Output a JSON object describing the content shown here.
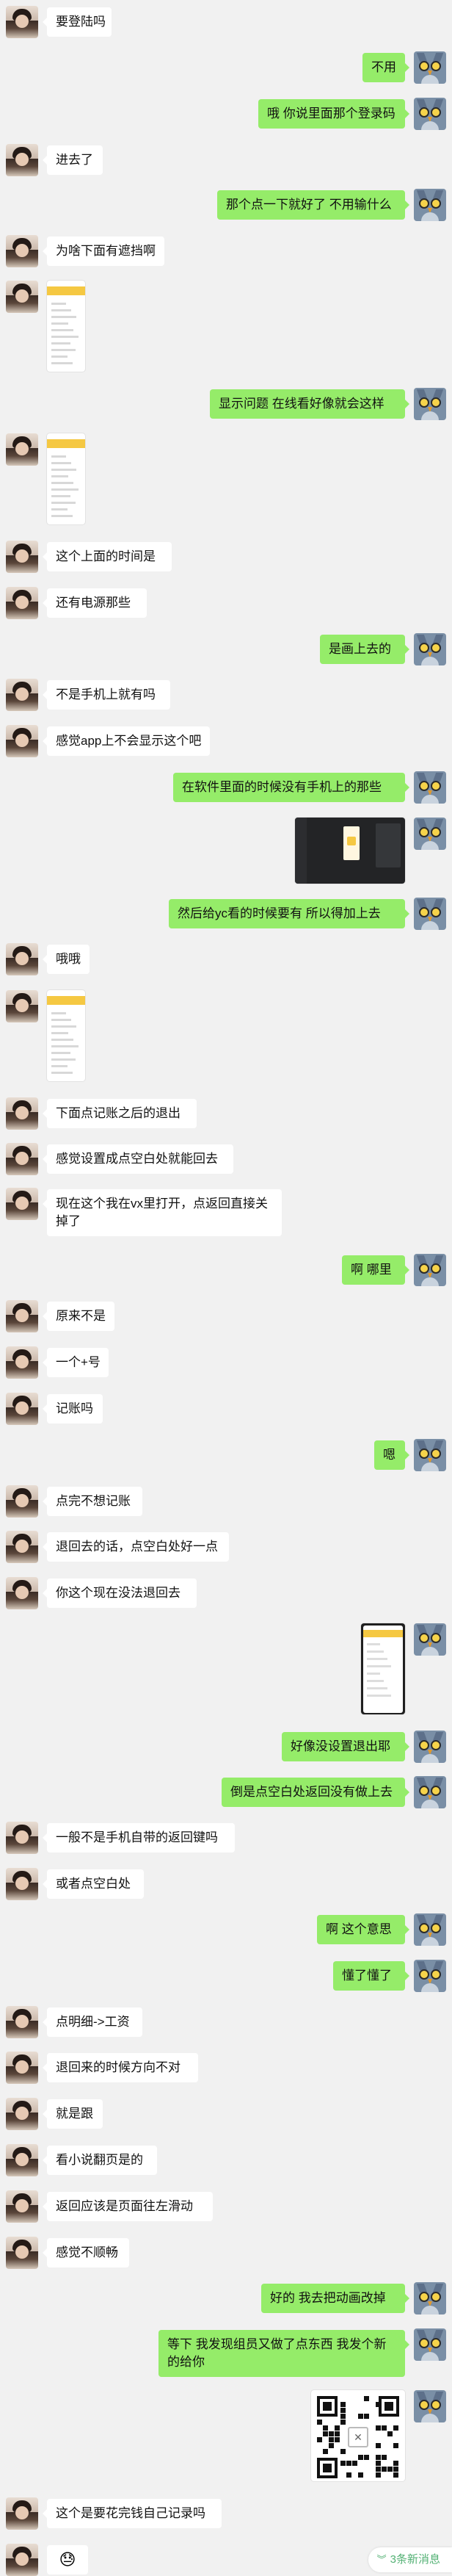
{
  "messages": [
    {
      "side": "left",
      "type": "text",
      "text": "要登陆吗"
    },
    {
      "side": "right",
      "type": "text",
      "text": "不用"
    },
    {
      "side": "right",
      "type": "text",
      "text": "哦 你说里面那个登录码"
    },
    {
      "side": "left",
      "type": "text",
      "text": "进去了"
    },
    {
      "side": "right",
      "type": "text",
      "text": "那个点一下就好了 不用输什么"
    },
    {
      "side": "left",
      "type": "text",
      "text": "为啥下面有遮挡啊"
    },
    {
      "side": "left",
      "type": "image",
      "kind": "phone-screenshot"
    },
    {
      "side": "right",
      "type": "text",
      "text": "显示问题  在线看好像就会这样"
    },
    {
      "side": "left",
      "type": "image",
      "kind": "phone-screenshot"
    },
    {
      "side": "left",
      "type": "text",
      "text": "这个上面的时间是"
    },
    {
      "side": "left",
      "type": "text",
      "text": "还有电源那些"
    },
    {
      "side": "right",
      "type": "text",
      "text": "是画上去的"
    },
    {
      "side": "left",
      "type": "text",
      "text": "不是手机上就有吗"
    },
    {
      "side": "left",
      "type": "text",
      "text": "感觉app上不会显示这个吧"
    },
    {
      "side": "right",
      "type": "text",
      "text": "在软件里面的时候没有手机上的那些"
    },
    {
      "side": "right",
      "type": "image",
      "kind": "design-tool-screenshot"
    },
    {
      "side": "right",
      "type": "text",
      "text": "然后给yc看的时候要有 所以得加上去"
    },
    {
      "side": "left",
      "type": "text",
      "text": "哦哦"
    },
    {
      "side": "left",
      "type": "image",
      "kind": "phone-screenshot"
    },
    {
      "side": "left",
      "type": "text",
      "text": "下面点记账之后的退出"
    },
    {
      "side": "left",
      "type": "text",
      "text": "感觉设置成点空白处就能回去"
    },
    {
      "side": "left",
      "type": "text",
      "text": "现在这个我在vx里打开，点返回直接关掉了"
    },
    {
      "side": "right",
      "type": "text",
      "text": "啊 哪里"
    },
    {
      "side": "left",
      "type": "text",
      "text": "原来不是"
    },
    {
      "side": "left",
      "type": "text",
      "text": "一个+号"
    },
    {
      "side": "left",
      "type": "text",
      "text": "记账吗"
    },
    {
      "side": "right",
      "type": "text",
      "text": "嗯"
    },
    {
      "side": "left",
      "type": "text",
      "text": "点完不想记账"
    },
    {
      "side": "left",
      "type": "text",
      "text": "退回去的话，点空白处好一点"
    },
    {
      "side": "left",
      "type": "text",
      "text": "你这个现在没法退回去"
    },
    {
      "side": "right",
      "type": "image",
      "kind": "phone-screenshot-tall"
    },
    {
      "side": "right",
      "type": "text",
      "text": "好像没设置退出耶"
    },
    {
      "side": "right",
      "type": "text",
      "text": "倒是点空白处返回没有做上去"
    },
    {
      "side": "left",
      "type": "text",
      "text": "一般不是手机自带的返回键吗"
    },
    {
      "side": "left",
      "type": "text",
      "text": "或者点空白处"
    },
    {
      "side": "right",
      "type": "text",
      "text": "啊 这个意思"
    },
    {
      "side": "right",
      "type": "text",
      "text": "懂了懂了"
    },
    {
      "side": "left",
      "type": "text",
      "text": "点明细->工资"
    },
    {
      "side": "left",
      "type": "text",
      "text": "退回来的时候方向不对"
    },
    {
      "side": "left",
      "type": "text",
      "text": "就是跟"
    },
    {
      "side": "left",
      "type": "text",
      "text": "看小说翻页是的"
    },
    {
      "side": "left",
      "type": "text",
      "text": "返回应该是页面往左滑动"
    },
    {
      "side": "left",
      "type": "text",
      "text": "感觉不顺畅"
    },
    {
      "side": "right",
      "type": "text",
      "text": "好的  我去把动画改掉"
    },
    {
      "side": "right",
      "type": "text",
      "text": "等下 我发现组员又做了点东西  我发个新的给你"
    },
    {
      "side": "right",
      "type": "image",
      "kind": "qr-code"
    },
    {
      "side": "left",
      "type": "text",
      "text": "这个是要花完钱自己记录吗"
    },
    {
      "side": "left",
      "type": "emoji",
      "text": "😓"
    }
  ],
  "new_messages_label": "3条新消息",
  "colors": {
    "background": "#f1f1f1",
    "bubble_mine": "#95ec69",
    "bubble_other": "#ffffff",
    "new_msg": "#53b174"
  }
}
